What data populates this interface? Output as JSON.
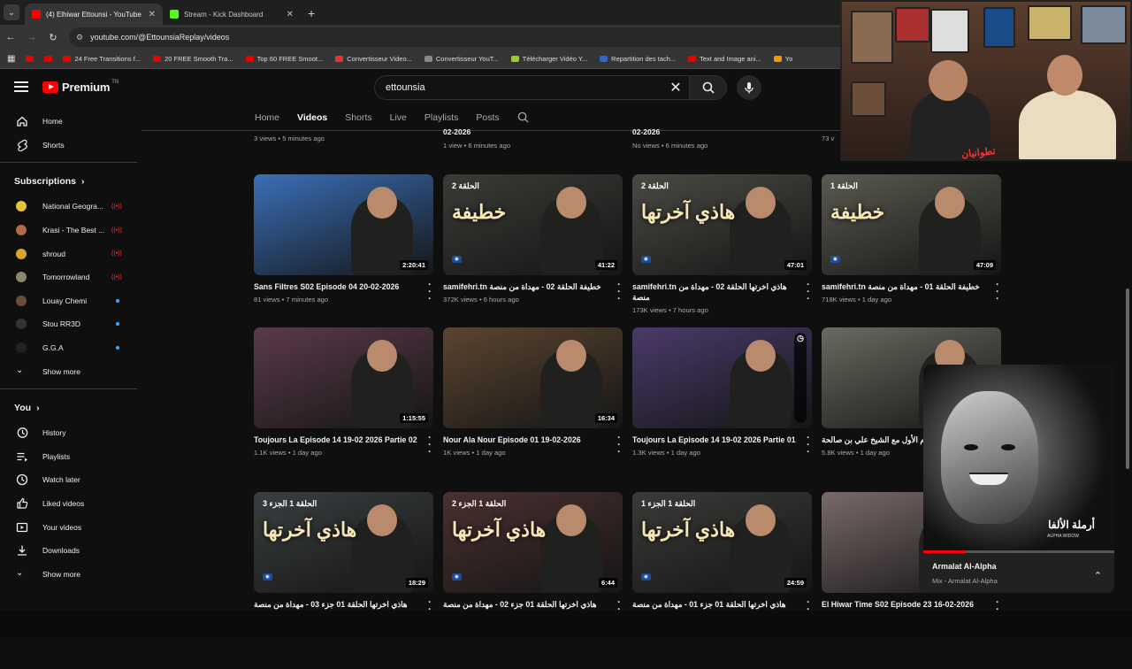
{
  "browser": {
    "tabs": [
      {
        "label": "(4) Elhiwar Ettounsi - YouTube",
        "color": "#ff0000",
        "active": true
      },
      {
        "label": "Stream - Kick Dashboard",
        "color": "#53fc18",
        "active": false
      }
    ],
    "url": "youtube.com/@EttounsiaReplay/videos",
    "bookmarks": [
      "24 Free Transitions f...",
      "20 FREE Smooth Tra...",
      "Top 60 FREE Smoot...",
      "Convertisseur Video...",
      "Convertisseur YouT...",
      "Télécharger Vidéo Y...",
      "Repartition des tach...",
      "Text and Image ani...",
      "Yo"
    ]
  },
  "youtube": {
    "logo": "Premium",
    "logo_sup": "TN",
    "search": {
      "query": "ettounsia"
    },
    "sidebar": {
      "top": [
        {
          "label": "Home",
          "icon": "home-icon"
        },
        {
          "label": "Shorts",
          "icon": "shorts-icon"
        }
      ],
      "subscriptions_title": "Subscriptions",
      "subscriptions": [
        {
          "name": "National Geogra...",
          "color": "#e6c23a",
          "status": "live"
        },
        {
          "name": "Krasi - The Best ...",
          "color": "#b46b4a",
          "status": "live"
        },
        {
          "name": "shroud",
          "color": "#d8a62c",
          "status": "live"
        },
        {
          "name": "Tomorrowland",
          "color": "#8a8a6a",
          "status": "live"
        },
        {
          "name": "Louay Chemi",
          "color": "#6b4b3a",
          "status": "new"
        },
        {
          "name": "Stou RR3D",
          "color": "#333333",
          "status": "new"
        },
        {
          "name": "G.G.A",
          "color": "#222222",
          "status": "new"
        }
      ],
      "show_more": "Show more",
      "you_title": "You",
      "you": [
        {
          "label": "History",
          "icon": "history-icon"
        },
        {
          "label": "Playlists",
          "icon": "playlists-icon"
        },
        {
          "label": "Watch later",
          "icon": "watch-later-icon"
        },
        {
          "label": "Liked videos",
          "icon": "liked-icon"
        },
        {
          "label": "Your videos",
          "icon": "your-videos-icon"
        },
        {
          "label": "Downloads",
          "icon": "downloads-icon"
        }
      ],
      "show_more2": "Show more"
    },
    "channel_tabs": [
      "Home",
      "Videos",
      "Shorts",
      "Live",
      "Playlists",
      "Posts"
    ],
    "active_tab": "Videos",
    "top_row": [
      {
        "title": "",
        "meta": "3 views • 5 minutes ago"
      },
      {
        "title": "02-2026",
        "meta": "1 view • 6 minutes ago"
      },
      {
        "title": "02-2026",
        "meta": "No views • 6 minutes ago"
      },
      {
        "title": "",
        "meta": "73 v"
      }
    ],
    "videos": [
      {
        "title": "Sans Filtres S02 Episode 04 20-02-2026",
        "meta": "81 views • 7 minutes ago",
        "duration": "2:20:41",
        "overlay": "",
        "bg": "#3a6fb8"
      },
      {
        "title": "samifehri.tn خطيفة الحلقة 02 - مهداة من منصة",
        "meta": "372K views • 6 hours ago",
        "duration": "41:22",
        "overlay": "الحلقة 2",
        "big": "خطيفة",
        "bg": "#3a3a36"
      },
      {
        "title": "samifehri.tn هاذي اخرتها الحلقة 02 - مهداة من منصة",
        "meta": "173K views • 7 hours ago",
        "duration": "47:01",
        "overlay": "الحلقة 2",
        "big": "هاذي آخرتها",
        "bg": "#4a4a44"
      },
      {
        "title": "samifehri.tn خطيفة الحلقة 01 - مهداة من منصة",
        "meta": "718K views • 1 day ago",
        "duration": "47:09",
        "overlay": "الحلقة 1",
        "big": "خطيفة",
        "bg": "#5a5a50"
      },
      {
        "title": "Toujours La Episode 14 19-02 2026 Partie 02",
        "meta": "1.1K views • 1 day ago",
        "duration": "1:15:55",
        "overlay": "",
        "bg": "#5a3a4a"
      },
      {
        "title": "Nour Ala Nour Episode 01 19-02-2026",
        "meta": "1K views • 1 day ago",
        "duration": "16:34",
        "overlay": "",
        "bg": "#5b4530"
      },
      {
        "title": "Toujours La Episode 14 19-02 2026 Partie 01",
        "meta": "1.3K views • 1 day ago",
        "duration": "",
        "overlay": "",
        "bg": "#4a3a6a"
      },
      {
        "title": "ح اليوم الأول مع الشيخ علي بن صالحة",
        "meta": "5.8K views • 1 day ago",
        "duration": "",
        "overlay": "",
        "bg": "#6a6a60"
      },
      {
        "title": "هاذي اخرتها الحلقة 01 جزء 03 - مهداة من منصة",
        "meta": "",
        "duration": "18:29",
        "overlay": "الحلقة 1 الجزء 3",
        "big": "هاذي آخرتها",
        "bg": "#3a3e40"
      },
      {
        "title": "هاذي اخرتها الحلقة 01 جزء 02 - مهداة من منصة",
        "meta": "",
        "duration": "6:44",
        "overlay": "الحلقة 1 الجزء 2",
        "big": "هاذي آخرتها",
        "bg": "#4a3030"
      },
      {
        "title": "هاذي اخرتها الحلقة 01 جزء 01 - مهداة من منصة",
        "meta": "",
        "duration": "24:59",
        "overlay": "الحلقة 1 الجزء 1",
        "big": "هاذي آخرتها",
        "bg": "#3a3a38"
      },
      {
        "title": "El Hiwar Time S02 Episode 23 16-02-2026",
        "meta": "",
        "duration": "",
        "overlay": "",
        "bg": "#7a6a6a"
      }
    ],
    "miniplayer": {
      "title": "Armalat Al-Alpha",
      "subtitle": "Mix - Armalat Al-Alpha",
      "art_text": "أرملة الألفا",
      "art_sub": "ALPHA WIDOW",
      "progress": 0.22
    }
  },
  "stream_overlay": {
    "tag": "تطوانيان"
  }
}
